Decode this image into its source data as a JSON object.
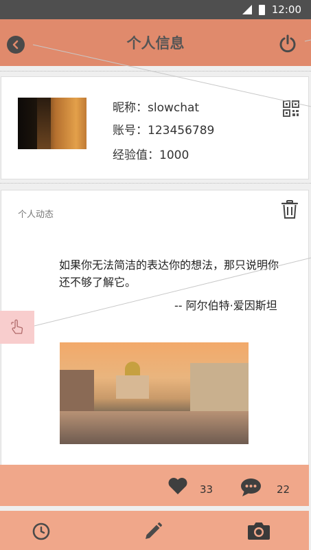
{
  "status_bar": {
    "time": "12:00"
  },
  "header": {
    "title": "个人信息"
  },
  "profile": {
    "nickname_label": "昵称：",
    "nickname": "slowchat",
    "account_label": "账号：",
    "account": "123456789",
    "exp_label": "经验值：",
    "exp": "1000"
  },
  "post": {
    "section_label": "个人动态",
    "quote": "如果你无法简洁的表达你的想法，那只说明你还不够了解它。",
    "author": "-- 阿尔伯特·爱因斯坦"
  },
  "actions": {
    "likes": "33",
    "comments": "22"
  },
  "colors": {
    "header": "#e08a6c",
    "action_bar": "#f0a78a",
    "status_bar": "#4f4f4f",
    "gesture_badge": "#f8cdcd"
  },
  "icons": [
    "back-icon",
    "power-icon",
    "qr-code-icon",
    "trash-icon",
    "gesture-icon",
    "heart-icon",
    "comment-icon",
    "clock-icon",
    "pencil-icon",
    "camera-icon"
  ]
}
